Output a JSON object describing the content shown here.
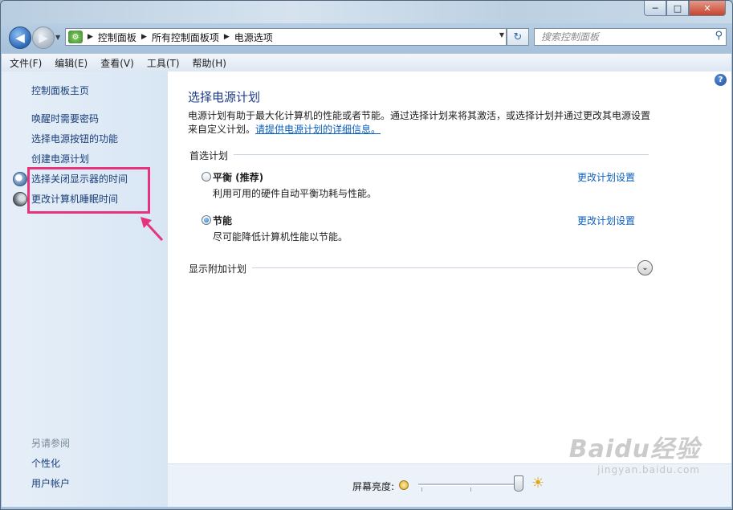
{
  "titlebar": {
    "minimize": "─",
    "maximize": "□",
    "close": "✕"
  },
  "address": {
    "crumbs": [
      "控制面板",
      "所有控制面板项",
      "电源选项"
    ],
    "search_placeholder": "搜索控制面板"
  },
  "menu": [
    "文件(F)",
    "编辑(E)",
    "查看(V)",
    "工具(T)",
    "帮助(H)"
  ],
  "sidebar": {
    "home": "控制面板主页",
    "links": [
      "唤醒时需要密码",
      "选择电源按钮的功能",
      "创建电源计划",
      "选择关闭显示器的时间",
      "更改计算机睡眠时间"
    ],
    "see_also_title": "另请参阅",
    "see_also": [
      "个性化",
      "用户帐户"
    ]
  },
  "main": {
    "title": "选择电源计划",
    "intro": "电源计划有助于最大化计算机的性能或者节能。通过选择计划来将其激活，或选择计划并通过更改其电源设置来自定义计划。",
    "intro_link": "请提供电源计划的详细信息。",
    "preferred_label": "首选计划",
    "plans": [
      {
        "name": "平衡 (推荐)",
        "desc": "利用可用的硬件自动平衡功耗与性能。",
        "link": "更改计划设置",
        "selected": false
      },
      {
        "name": "节能",
        "desc": "尽可能降低计算机性能以节能。",
        "link": "更改计划设置",
        "selected": true
      }
    ],
    "more_plans": "显示附加计划"
  },
  "brightness": {
    "label": "屏幕亮度:",
    "level": 0.95
  },
  "watermark": {
    "logo": "Baidu经验",
    "url": "jingyan.baidu.com"
  }
}
